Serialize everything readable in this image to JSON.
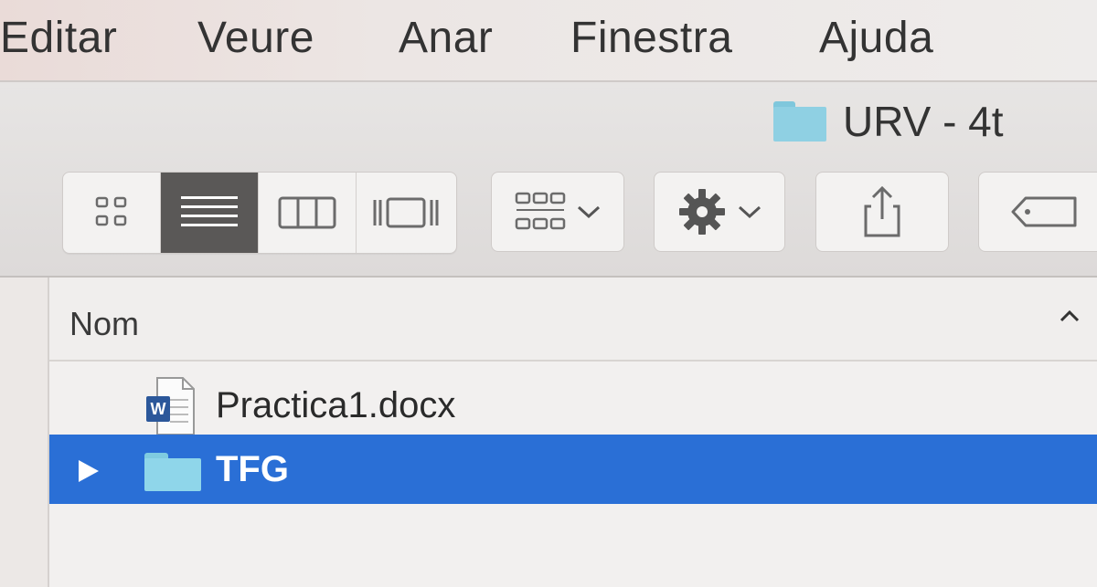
{
  "menubar": {
    "items": [
      "Editar",
      "Veure",
      "Anar",
      "Finestra",
      "Ajuda"
    ]
  },
  "window": {
    "title": "URV - 4t",
    "title_icon": "folder-icon"
  },
  "toolbar": {
    "view_modes": [
      {
        "name": "icon-view",
        "icon": "grid-icon",
        "active": false
      },
      {
        "name": "list-view",
        "icon": "list-icon",
        "active": true
      },
      {
        "name": "column-view",
        "icon": "columns-icon",
        "active": false
      },
      {
        "name": "gallery-view",
        "icon": "gallery-icon",
        "active": false
      }
    ],
    "group_button_icon": "group-by-icon",
    "action_button_icon": "gear-icon",
    "share_button_icon": "share-icon",
    "tag_button_icon": "tag-icon"
  },
  "list": {
    "column_header": "Nom",
    "sort_direction": "ascending",
    "rows": [
      {
        "label": "Practica1.docx",
        "icon": "word-document-icon",
        "selected": false
      },
      {
        "label": "TFG",
        "icon": "folder-icon",
        "selected": true
      }
    ]
  },
  "colors": {
    "selection": "#2a6fd6",
    "folder": "#8fd6ea",
    "active_segment": "#5a5857"
  }
}
